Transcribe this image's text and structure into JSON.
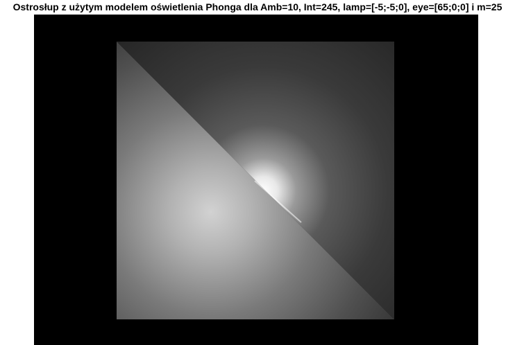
{
  "title": "Ostrosłup z użytym modelem oświetlenia Phonga dla Amb=10, Int=245, lamp=[-5;-5;0], eye=[65;0;0] i m=25",
  "scene": {
    "background_color": "#000000",
    "object": "pyramid",
    "shading": "Phong",
    "faces": [
      {
        "name": "upper-right-face",
        "base_color": "#2e2e2e",
        "highlight_color": "#ffffff"
      },
      {
        "name": "lower-left-face",
        "base_color": "#3c3c3c",
        "highlight_color": "#d2d2d2"
      }
    ]
  }
}
